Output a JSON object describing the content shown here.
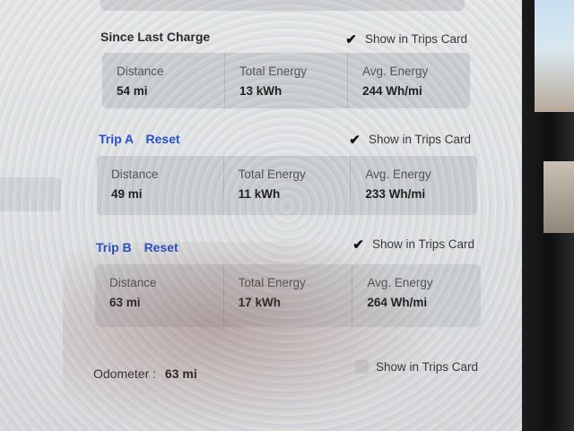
{
  "since_last_charge": {
    "title": "Since Last Charge",
    "show_in_trips_card": "Show in Trips Card",
    "checked": true,
    "stats": [
      {
        "label": "Distance",
        "value": "54 mi"
      },
      {
        "label": "Total Energy",
        "value": "13 kWh"
      },
      {
        "label": "Avg. Energy",
        "value": "244 Wh/mi"
      }
    ]
  },
  "trip_a": {
    "title": "Trip A",
    "reset": "Reset",
    "show_in_trips_card": "Show in Trips Card",
    "checked": true,
    "stats": [
      {
        "label": "Distance",
        "value": "49 mi"
      },
      {
        "label": "Total Energy",
        "value": "11 kWh"
      },
      {
        "label": "Avg. Energy",
        "value": "233 Wh/mi"
      }
    ]
  },
  "trip_b": {
    "title": "Trip B",
    "reset": "Reset",
    "show_in_trips_card": "Show in Trips Card",
    "checked": true,
    "stats": [
      {
        "label": "Distance",
        "value": "63 mi"
      },
      {
        "label": "Total Energy",
        "value": "17 kWh"
      },
      {
        "label": "Avg. Energy",
        "value": "264 Wh/mi"
      }
    ]
  },
  "odometer": {
    "label": "Odometer :",
    "value": "63 mi",
    "show_in_trips_card": "Show in Trips Card",
    "checked": false
  },
  "colors": {
    "accent_blue": "#2a52c8",
    "card_bg": "#cfd1d2"
  }
}
